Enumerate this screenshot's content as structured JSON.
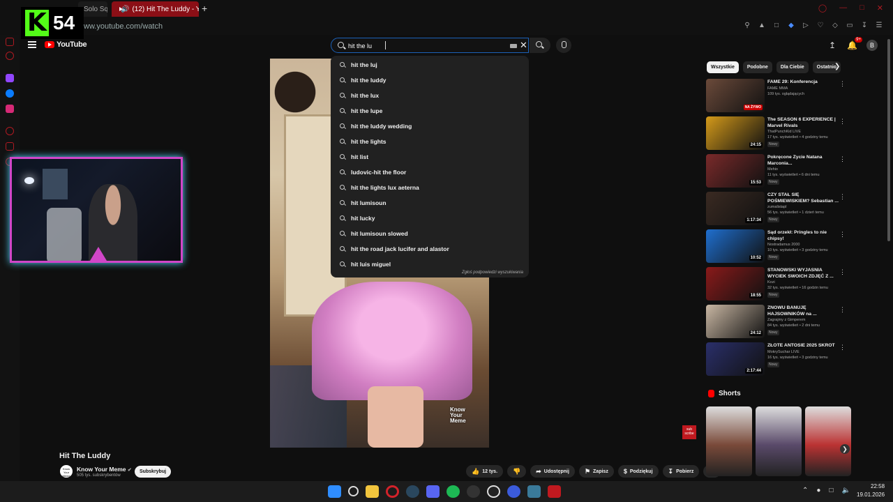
{
  "browser": {
    "tabs": [
      {
        "title": "Solo Sq...",
        "active": false
      },
      {
        "title": "(12) Hit The Luddy - Y...",
        "active": true
      }
    ],
    "new_tab_symbol": "+",
    "url": "ww.youtube.com/watch"
  },
  "overlay": {
    "kick_logo": "K",
    "viewer_count": "54"
  },
  "youtube": {
    "logo_text": "YouTube",
    "search": {
      "query": "hit the lu",
      "clear_symbol": "✕"
    },
    "notifications_badge": "9+",
    "avatar_letter": "B",
    "suggestions": [
      "hit the luj",
      "hit the luddy",
      "hit the lux",
      "hit the lupe",
      "hit the luddy wedding",
      "hit the lights",
      "hit list",
      "ludovic-hit the floor",
      "hit the lights lux aeterna",
      "hit lumisoun",
      "hit lucky",
      "hit lumisoun slowed",
      "hit the road jack lucifer and alastor",
      "hit luis miguel"
    ],
    "suggestions_report": "Zgłoś podpowiedzi wyszukiwania",
    "video": {
      "watermark": "Know Your Meme",
      "title": "Hit The Luddy",
      "channel": "Know Your Meme",
      "channel_logo": "Know Your Meme",
      "subscribers": "505 tys. subskrybentów",
      "subscribe_label": "Subskrybuj",
      "actions": {
        "likes": "12 tys.",
        "share": "Udostępnij",
        "save": "Zapisz",
        "thanks": "Podziękuj",
        "download": "Pobierz"
      }
    },
    "chips": [
      "Wszystkie",
      "Podobne",
      "Dla Ciebie",
      "Ostatnio"
    ],
    "recommendations": [
      {
        "title": "FAME 29: Konferencja",
        "channel": "FAME MMA",
        "meta": "109 tys. oglądających",
        "badge": "NA ŻYWO",
        "new": false,
        "thumb_color": "#6b4a3a"
      },
      {
        "title": "The SEASON 6 EXPERIENCE | Marvel Rivals",
        "channel": "ThatPunchKid LIVE",
        "meta": "17 tys. wyświetleń • 4 godziny temu",
        "badge": "24:15",
        "new": true,
        "thumb_color": "#d49a1a"
      },
      {
        "title": "Pokręcone Życie Natana Marconia...",
        "channel": "Mehio",
        "meta": "11 tys. wyświetleń • 6 dni temu",
        "badge": "15:53",
        "new": true,
        "thumb_color": "#7a2a2a"
      },
      {
        "title": "CZY STAŁ SIĘ POŚMIEWISKIEM? Sebastian ...",
        "channel": "zumalistapl",
        "meta": "56 tys. wyświetleń • 1 dzień temu",
        "badge": "1:17:34",
        "new": true,
        "thumb_color": "#3a2a22"
      },
      {
        "title": "Sąd orzekł: Pringles to nie chipsy!",
        "channel": "Nostradamus 2000",
        "meta": "10 tys. wyświetleń • 3 godziny temu",
        "badge": "10:52",
        "new": true,
        "thumb_color": "#1f6fcf"
      },
      {
        "title": "STANOWSKI WYJAŚNIA WYCIEK SWOICH ZDJĘĆ Z ...",
        "channel": "Kozi",
        "meta": "32 tys. wyświetleń • 16 godzin temu",
        "badge": "18:55",
        "new": true,
        "thumb_color": "#8a1a1a"
      },
      {
        "title": "ZNOWU BANUJĘ HAJSOWNIKÓW na ...",
        "channel": "Zagrajmy z Gimperem",
        "meta": "84 tys. wyświetleń • 2 dni temu",
        "badge": "24:12",
        "new": true,
        "thumb_color": "#c9b7a3"
      },
      {
        "title": "ZŁOTE ANTOSIE 2025 SKRÓT",
        "channel": "MokrySuchar LIVE",
        "meta": "16 tys. wyświetleń • 3 godziny temu",
        "badge": "2:17:44",
        "new": true,
        "thumb_color": "#2a2f6a"
      }
    ],
    "new_label": "Nowy",
    "shorts_title": "Shorts",
    "shorts_colors": [
      "#7a4a3a",
      "#5a4a6a",
      "#b33"
    ],
    "subscribe_sticker": "sub scribe"
  },
  "taskbar": {
    "time": "22:58",
    "date": "19.01.2026"
  }
}
